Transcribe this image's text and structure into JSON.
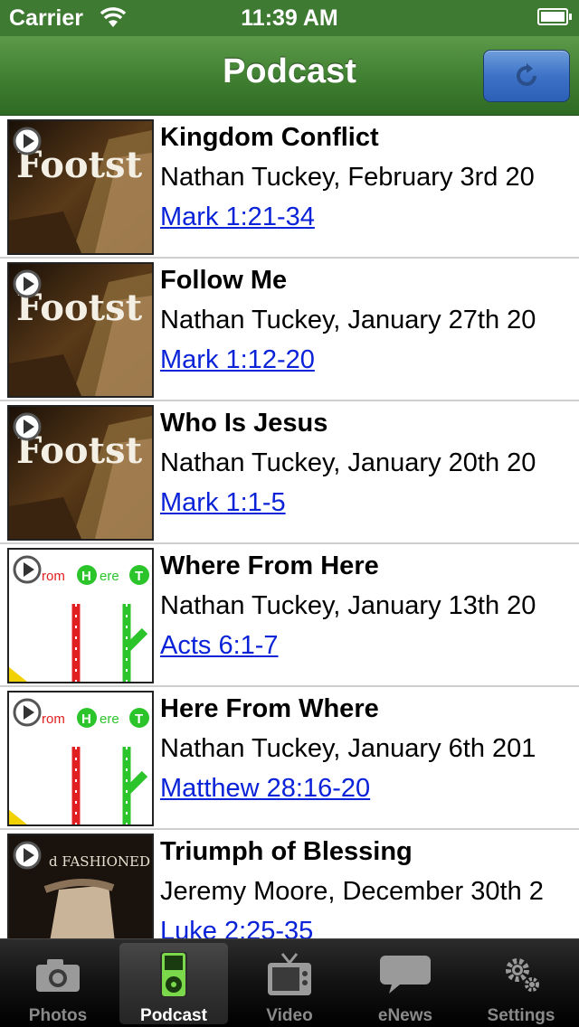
{
  "status_bar": {
    "carrier": "Carrier",
    "time": "11:39 AM"
  },
  "nav": {
    "title": "Podcast",
    "refresh_icon": "refresh-icon"
  },
  "colors": {
    "nav_green": "#3f7f31",
    "link_blue": "#0a22d8",
    "refresh_blue": "#3d72c7"
  },
  "episodes": [
    {
      "title": "Kingdom Conflict",
      "byline": "Nathan Tuckey, February 3rd 20",
      "scripture": "Mark 1:21-34",
      "artwork": "footsteps",
      "art_text": "Footst"
    },
    {
      "title": "Follow Me",
      "byline": "Nathan Tuckey, January 27th 20",
      "scripture": "Mark 1:12-20",
      "artwork": "footsteps",
      "art_text": "Footst"
    },
    {
      "title": "Who Is Jesus",
      "byline": "Nathan Tuckey, January 20th 20",
      "scripture": "Mark 1:1-5",
      "artwork": "footsteps",
      "art_text": "Footst"
    },
    {
      "title": "Where From Here",
      "byline": "Nathan Tuckey, January 13th 20",
      "scripture": "Acts 6:1-7",
      "artwork": "transit",
      "art_text": "rom H ere T"
    },
    {
      "title": "Here From Where",
      "byline": "Nathan Tuckey, January 6th 201",
      "scripture": "Matthew 28:16-20",
      "artwork": "transit",
      "art_text": "rom H ere T"
    },
    {
      "title": "Triumph of Blessing",
      "byline": "Jeremy Moore, December 30th 2",
      "scripture": "Luke 2:25-35",
      "artwork": "scroll",
      "art_text": "d FASHIONED"
    }
  ],
  "tabs": [
    {
      "label": "Photos",
      "icon": "camera-icon",
      "active": false
    },
    {
      "label": "Podcast",
      "icon": "ipod-icon",
      "active": true
    },
    {
      "label": "Video",
      "icon": "tv-icon",
      "active": false
    },
    {
      "label": "eNews",
      "icon": "speech-bubble-icon",
      "active": false
    },
    {
      "label": "Settings",
      "icon": "gear-icon",
      "active": false
    }
  ]
}
